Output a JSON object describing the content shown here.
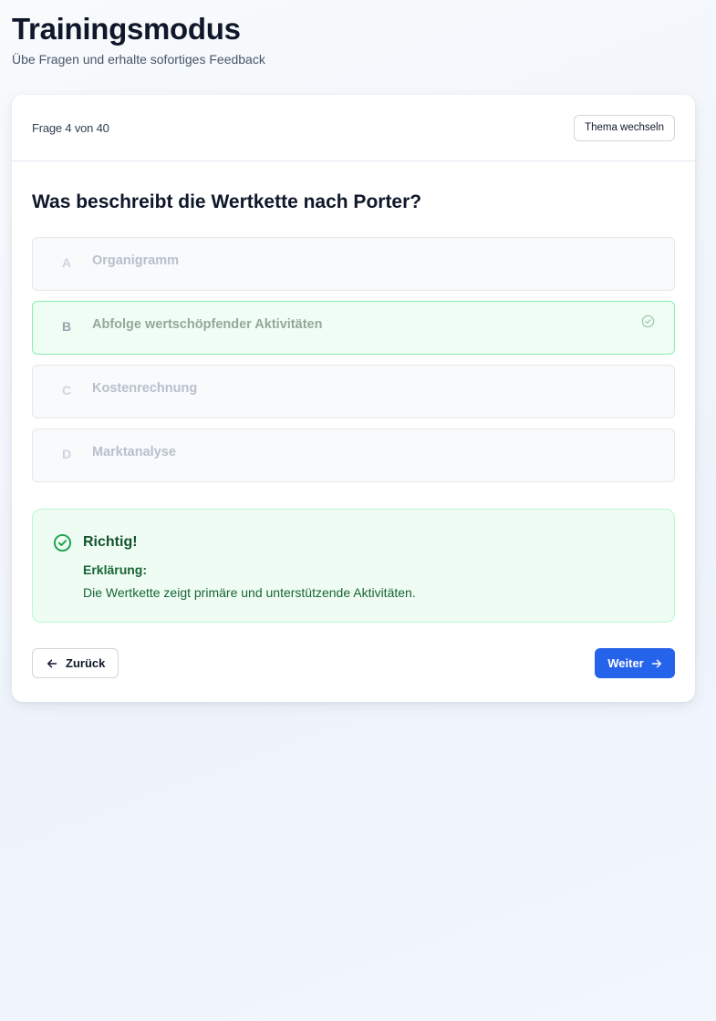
{
  "page": {
    "title": "Trainingsmodus",
    "subtitle": "Übe Fragen und erhalte sofortiges Feedback"
  },
  "quiz": {
    "progress_label": "Frage 4 von 40",
    "switch_topic_label": "Thema wechseln",
    "question": "Was beschreibt die Wertkette nach Porter?",
    "options": [
      {
        "letter": "A",
        "text": "Organigramm",
        "state": "disabled"
      },
      {
        "letter": "B",
        "text": "Abfolge wertschöpfender Aktivitäten",
        "state": "correct"
      },
      {
        "letter": "C",
        "text": "Kostenrechnung",
        "state": "disabled"
      },
      {
        "letter": "D",
        "text": "Marktanalyse",
        "state": "disabled"
      }
    ]
  },
  "feedback": {
    "title": "Richtig!",
    "explanation_label": "Erklärung:",
    "explanation_text": "Die Wertkette zeigt primäre und unterstützende Aktivitäten."
  },
  "navigation": {
    "back_label": "Zurück",
    "next_label": "Weiter"
  },
  "colors": {
    "accent": "#2563eb",
    "success_bg": "#effcf4",
    "success_border": "#bbf7d0",
    "success_text": "#166534"
  },
  "icons": {
    "check_circle": "check-circle-icon",
    "arrow_left": "arrow-left-icon",
    "arrow_right": "arrow-right-icon"
  }
}
